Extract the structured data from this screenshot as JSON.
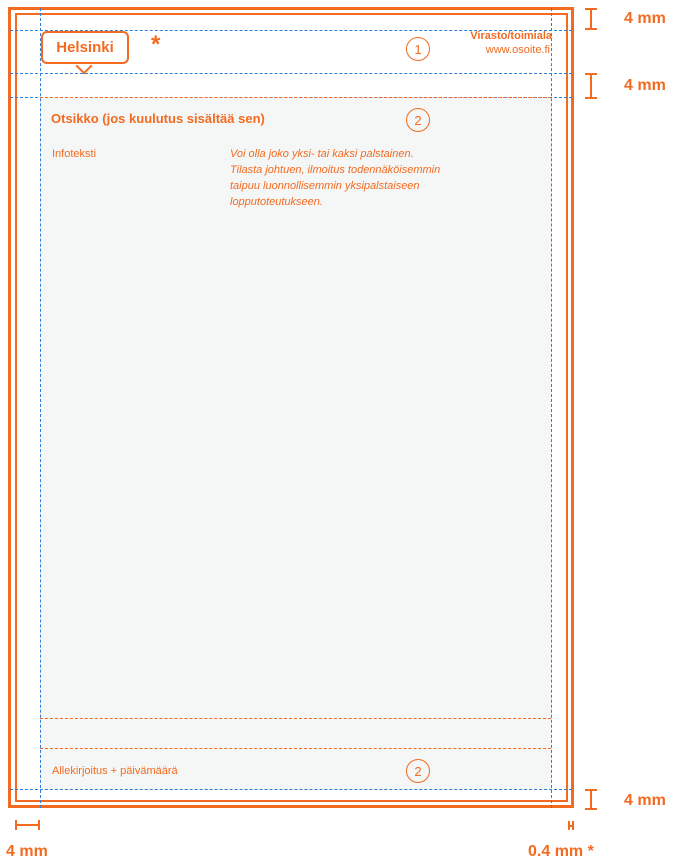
{
  "header": {
    "logo_text": "Helsinki",
    "asterisk": "*",
    "department": "Virasto/toimiala",
    "url": "www.osoite.fi",
    "marker_1": "1"
  },
  "content": {
    "title": "Otsikko (jos kuulutus sisältää sen)",
    "marker_title": "2",
    "info_label": "Infoteksti",
    "body_lines": [
      "Voi olla joko yksi- tai kaksi palstainen.",
      "Tilasta johtuen, ilmoitus todennäköisemmin",
      "taipuu luonnollisemmin yksipalstaiseen",
      "lopputoteutukseen."
    ]
  },
  "footer": {
    "signature": "Allekirjoitus + päivämäärä",
    "marker_footer": "2"
  },
  "dimensions": {
    "top_margin": "4 mm",
    "header_gap": "4 mm",
    "bottom_margin": "4 mm",
    "left_margin": "4 mm",
    "stroke_width": "0.4 mm *"
  },
  "colors": {
    "accent": "#f26b21",
    "guide": "#2f7fd8",
    "content_background": "#f5f6f6"
  }
}
